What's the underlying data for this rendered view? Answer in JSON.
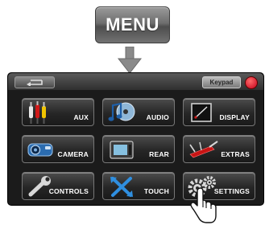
{
  "hardware": {
    "menu_label": "MENU"
  },
  "screen": {
    "keypad_label": "Keypad",
    "tiles": [
      {
        "label": "AUX",
        "icon": "aux-cables-icon"
      },
      {
        "label": "AUDIO",
        "icon": "music-note-cd-icon"
      },
      {
        "label": "DISPLAY",
        "icon": "display-frame-icon"
      },
      {
        "label": "CAMERA",
        "icon": "camera-icon"
      },
      {
        "label": "REAR",
        "icon": "rear-monitor-icon"
      },
      {
        "label": "EXTRAS",
        "icon": "swiss-knife-icon"
      },
      {
        "label": "CONTROLS",
        "icon": "wrench-icon"
      },
      {
        "label": "TOUCH",
        "icon": "touch-arrows-icon"
      },
      {
        "label": "SETTINGS",
        "icon": "gears-icon"
      }
    ]
  },
  "colors": {
    "power": "#c4001a",
    "screen_bg": "#1b1b1b",
    "touch_icon": "#2f8fe0"
  }
}
